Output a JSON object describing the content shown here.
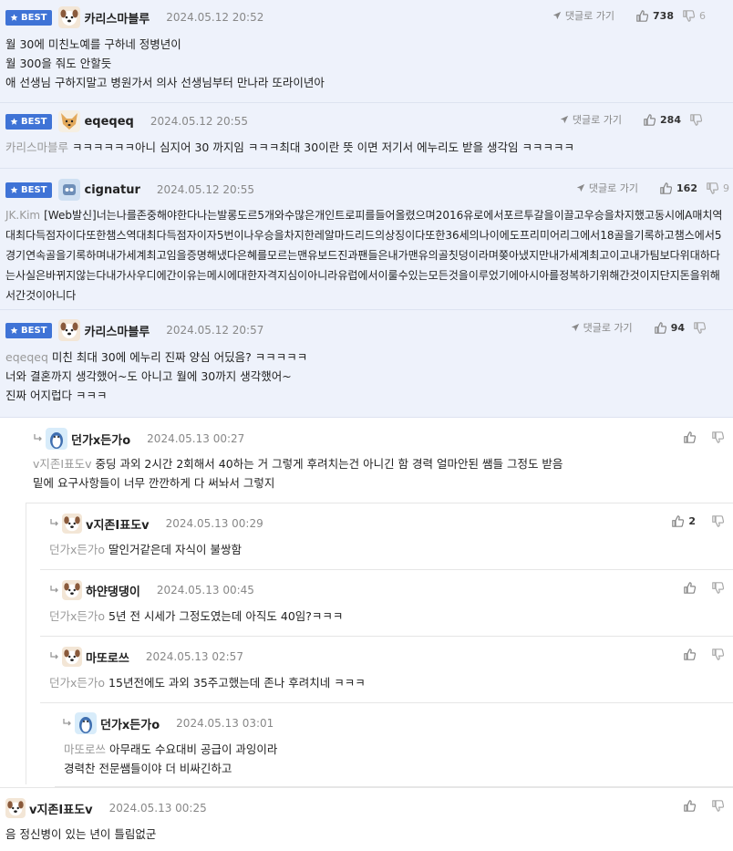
{
  "labels": {
    "best": "BEST",
    "reply": "댓글로 가기"
  },
  "colors": {
    "best_bg": "#eef2fb",
    "badge": "#3f73d6",
    "accent": "#3f73d6"
  },
  "comments": [
    {
      "best": true,
      "user": "카리스마블루",
      "date": "2024.05.12 20:52",
      "likes": "738",
      "dislikes": "6",
      "mention": "",
      "text": "월 30에 미친노예를 구하네 정병년이\n월 300을 줘도 안할듯\n애 선생님 구하지말고 병원가서 의사 선생님부터 만나라 또라이년아",
      "avatar": "dog-avatar-icon"
    },
    {
      "best": true,
      "user": "eqeqeq",
      "date": "2024.05.12 20:55",
      "likes": "284",
      "dislikes": "",
      "mention": "카리스마블루",
      "text": "ㅋㅋㅋㅋㅋㅋ아니 심지어 30 까지임 ㅋㅋㅋ최대 30이란 뜻 이면 저기서 에누리도 받을 생각임 ㅋㅋㅋㅋㅋ",
      "avatar": "dog-avatar-icon"
    },
    {
      "best": true,
      "user": "cignatur",
      "date": "2024.05.12 20:55",
      "likes": "162",
      "dislikes": "9",
      "mention": "JK.Kim",
      "text": "[Web발신]너는나를존중해야한다나는발롱도르5개와수많은개인트로피를들어올렸으며2016유로에서포르투갈을이끌고우승을차지했고동시에A매치역대최다득점자이다또한챔스역대최다득점자이자5번이나우승을차지한레알마드리드의상징이다또한36세의나이에도프리미어리그에서18골을기록하고챔스에서5경기연속골을기록하며내가세계최고임을증명해냈다은혜를모르는맨유보드진과팬들은내가맨유의골칫덩이라며쫒아냈지만내가세계최고이고내가팀보다위대하다는사실은바뀌지않는다내가사우디에간이유는메시에대한자격지심이아니라유럽에서이룰수있는모든것을이루었기에아시아를정복하기위해간것이지단지돈을위해서간것이아니다",
      "avatar": "robot-avatar-icon"
    },
    {
      "best": true,
      "user": "카리스마블루",
      "date": "2024.05.12 20:57",
      "likes": "94",
      "dislikes": "",
      "mention": "eqeqeq",
      "text": "미친 최대 30에 에누리 진짜 양심 어딨음? ㅋㅋㅋㅋㅋ\n너와 결혼까지 생각했어~도 아니고 월에 30까지 생각했어~\n진짜 어지럽다 ㅋㅋㅋ",
      "avatar": "dog-avatar-icon"
    },
    {
      "best": false,
      "user": "던가x든가o",
      "date": "2024.05.13 00:27",
      "likes": "",
      "dislikes": "",
      "mention": "v지존I표도v",
      "text": "중딩 과외 2시간 2회해서 40하는 거 그렇게 후려치는건 아니긴 함 경력 얼마안된 쌤들 그정도 받음\n밑에 요구사항들이 너무 깐깐하게 다 써놔서 그렇지",
      "avatar": "penguin-avatar-icon"
    },
    {
      "best": false,
      "user": "v지존I표도v",
      "date": "2024.05.13 00:29",
      "likes": "2",
      "dislikes": "",
      "mention": "던가x든가o",
      "text": "딸인거같은데 자식이 불쌍함",
      "avatar": "dog-avatar-icon"
    },
    {
      "best": false,
      "user": "하얀댕댕이",
      "date": "2024.05.13 00:45",
      "likes": "",
      "dislikes": "",
      "mention": "던가x든가o",
      "text": "5년 전 시세가 그정도였는데 아직도 40임?ㅋㅋㅋ",
      "avatar": "dog-avatar-icon"
    },
    {
      "best": false,
      "user": "마또로쓰",
      "date": "2024.05.13 02:57",
      "likes": "",
      "dislikes": "",
      "mention": "던가x든가o",
      "text": "15년전에도 과외 35주고했는데 존나 후려치네 ㅋㅋㅋ",
      "avatar": "dog-avatar-icon"
    },
    {
      "best": false,
      "user": "던가x든가o",
      "date": "2024.05.13 03:01",
      "likes": "",
      "dislikes": "",
      "mention": "마또로쓰",
      "text": "아무래도 수요대비 공급이 과잉이라\n경력찬 전문쌤들이야 더 비싸긴하고",
      "avatar": "penguin-avatar-icon"
    },
    {
      "best": false,
      "user": "v지존I표도v",
      "date": "2024.05.13 00:25",
      "likes": "",
      "dislikes": "",
      "mention": "",
      "text": "음 정신병이 있는 년이 틀림없군",
      "avatar": "dog-avatar-icon"
    }
  ]
}
